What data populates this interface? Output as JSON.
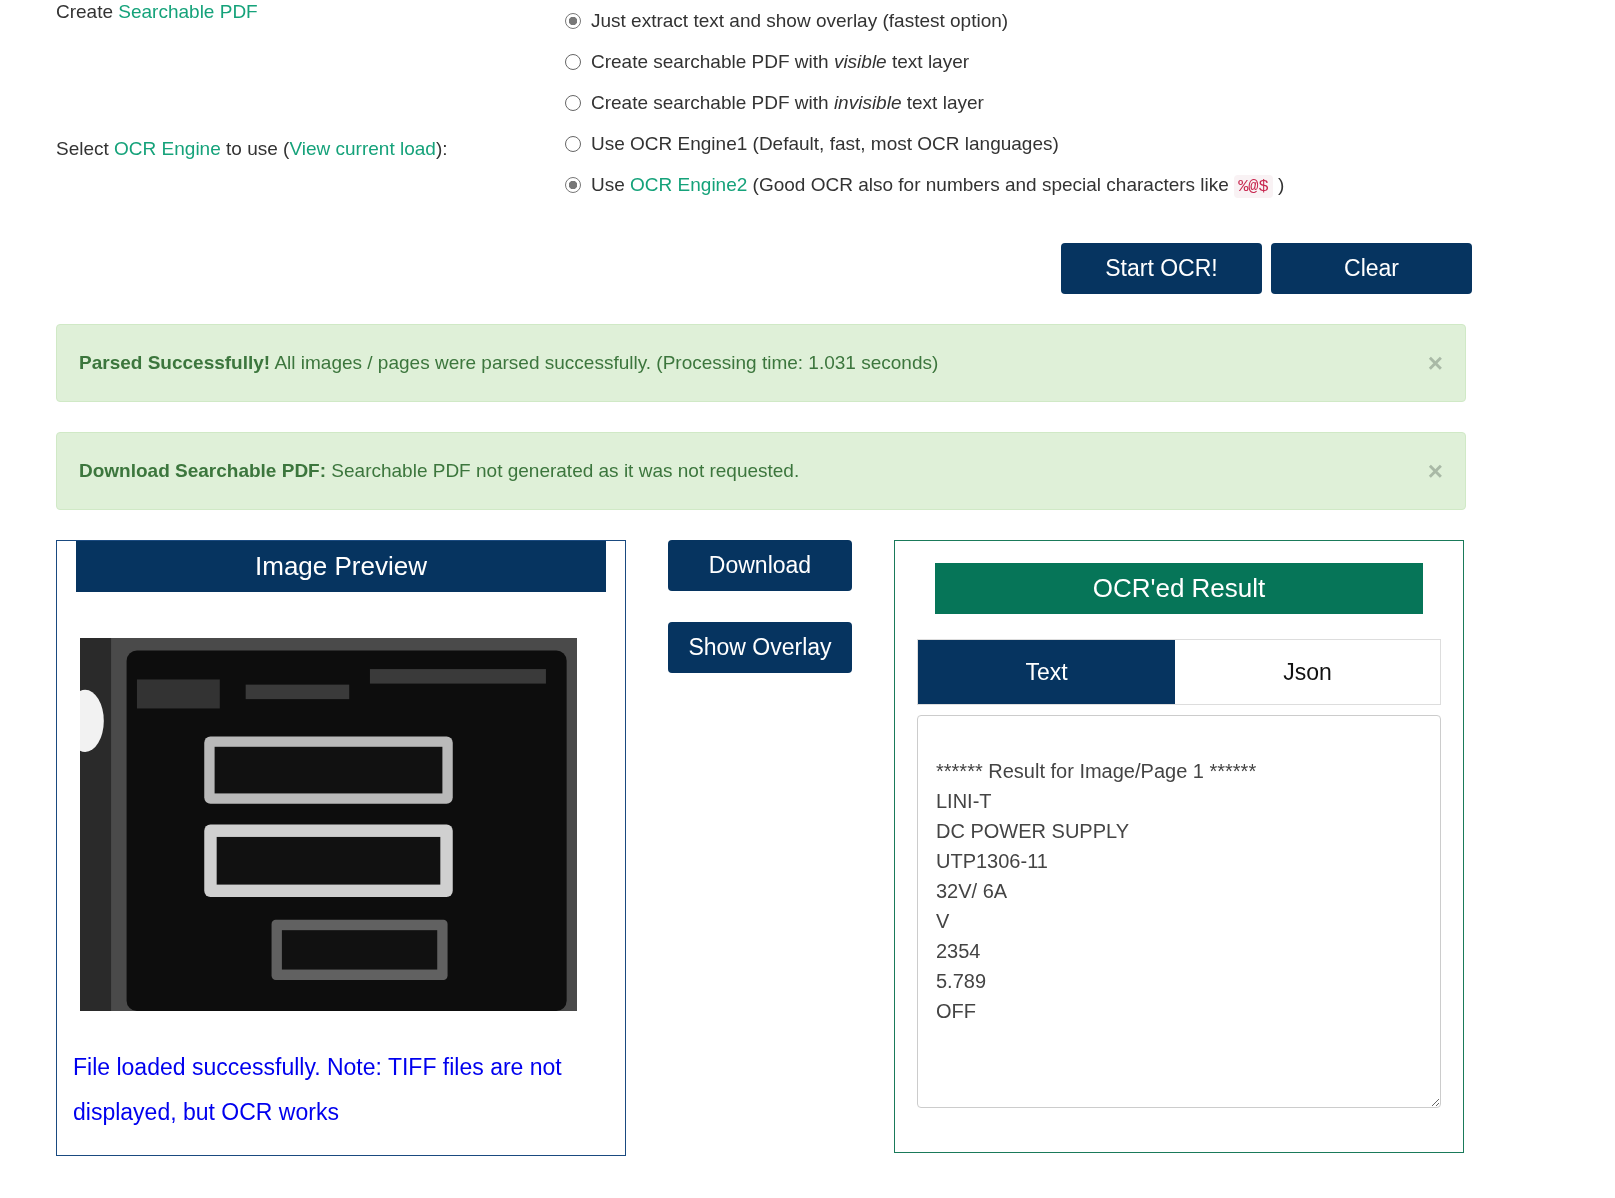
{
  "pdf_setting": {
    "label": [
      {
        "kind": "text",
        "text": "Create "
      },
      {
        "kind": "link",
        "text": "Searchable PDF"
      }
    ],
    "options": [
      {
        "selected": true,
        "segments": [
          {
            "kind": "text",
            "text": "Just extract text and show overlay (fastest option)"
          }
        ]
      },
      {
        "selected": false,
        "segments": [
          {
            "kind": "text",
            "text": "Create searchable PDF with *visible* text layer"
          }
        ]
      },
      {
        "selected": false,
        "segments": [
          {
            "kind": "text",
            "text": "Create searchable PDF with *invisible* text layer"
          }
        ]
      }
    ]
  },
  "engine_setting": {
    "label": [
      {
        "kind": "text",
        "text": "Select "
      },
      {
        "kind": "link",
        "text": "OCR Engine"
      },
      {
        "kind": "text",
        "text": " to use ("
      },
      {
        "kind": "link",
        "text": "View current load"
      },
      {
        "kind": "text",
        "text": "):"
      }
    ],
    "options": [
      {
        "selected": false,
        "segments": [
          {
            "kind": "text",
            "text": "Use OCR Engine1 (Default, fast, most OCR languages)"
          }
        ]
      },
      {
        "selected": true,
        "segments": [
          {
            "kind": "text",
            "text": "Use "
          },
          {
            "kind": "link",
            "text": "OCR Engine2"
          },
          {
            "kind": "text",
            "text": " (Good OCR also for numbers and special characters like "
          },
          {
            "kind": "code",
            "text": "%@$"
          },
          {
            "kind": "text",
            "text": " )"
          }
        ]
      }
    ]
  },
  "actions": [
    "Start OCR!",
    "Clear"
  ],
  "alerts": [
    {
      "title": "Parsed Successfully!",
      "message": "All images / pages were parsed successfully. (Processing time: 1.031 seconds)",
      "close": "×"
    },
    {
      "title": "Download Searchable PDF:",
      "message": "Searchable PDF not generated as it was not requested.",
      "close": "×"
    }
  ],
  "preview": {
    "title": "Image Preview",
    "note": "File loaded successfully. Note: TIFF files are not displayed, but OCR works"
  },
  "middle_buttons": [
    "Download",
    "Show Overlay"
  ],
  "result": {
    "title": "OCR'ed Result",
    "tabs": [
      {
        "label": "Text",
        "selected": true
      },
      {
        "label": "Json",
        "selected": false
      }
    ],
    "text": "****** Result for Image/Page 1 ******\nLINI-T\nDC POWER SUPPLY\nUTP1306-11\n32V/ 6A\nV\n2354\n5.789\nOFF"
  }
}
